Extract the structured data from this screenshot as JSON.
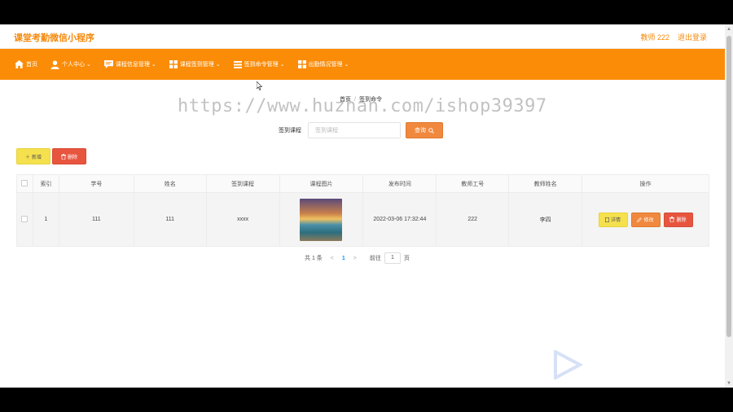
{
  "app": {
    "title": "课堂考勤微信小程序",
    "user_label": "教师 222",
    "logout_label": "退出登录"
  },
  "nav": {
    "items": [
      {
        "label": "首页",
        "icon": "home-icon",
        "has_dropdown": false
      },
      {
        "label": "个人中心",
        "icon": "user-icon",
        "has_dropdown": true
      },
      {
        "label": "课程信息管理",
        "icon": "chat-icon",
        "has_dropdown": true
      },
      {
        "label": "课程签到管理",
        "icon": "grid-icon",
        "has_dropdown": true
      },
      {
        "label": "签到命令管理",
        "icon": "list-icon",
        "has_dropdown": true
      },
      {
        "label": "出勤情况管理",
        "icon": "grid-icon",
        "has_dropdown": true
      }
    ],
    "chevron": "⌄"
  },
  "breadcrumb": {
    "home": "首页",
    "separator": "/",
    "current": "签到命令"
  },
  "watermark": "https://www.huzhan.com/ishop39397",
  "search": {
    "label": "签到课程",
    "placeholder": "签到课程",
    "button_label": "查询"
  },
  "actions": {
    "add_label": "新增",
    "delete_label": "删除"
  },
  "table": {
    "columns": [
      "索引",
      "学号",
      "姓名",
      "签到课程",
      "课程图片",
      "发布时间",
      "教师工号",
      "教师姓名",
      "操作"
    ],
    "rows": [
      {
        "index": "1",
        "student_no": "111",
        "name": "111",
        "course": "xxxx",
        "published": "2022-03-06 17:32:44",
        "teacher_no": "222",
        "teacher_name": "李四"
      }
    ],
    "row_actions": {
      "detail": "详情",
      "edit": "修改",
      "delete": "删除"
    }
  },
  "pagination": {
    "total_text": "共 1 条",
    "prev": "<",
    "current": "1",
    "next": ">",
    "goto_label": "前往",
    "page_value": "1",
    "page_suffix": "页"
  },
  "colors": {
    "primary": "#fb8c08",
    "brand_text": "#f58a0c",
    "add_button": "#f5e04e",
    "delete_button": "#e8553f",
    "search_button": "#f0883e"
  }
}
